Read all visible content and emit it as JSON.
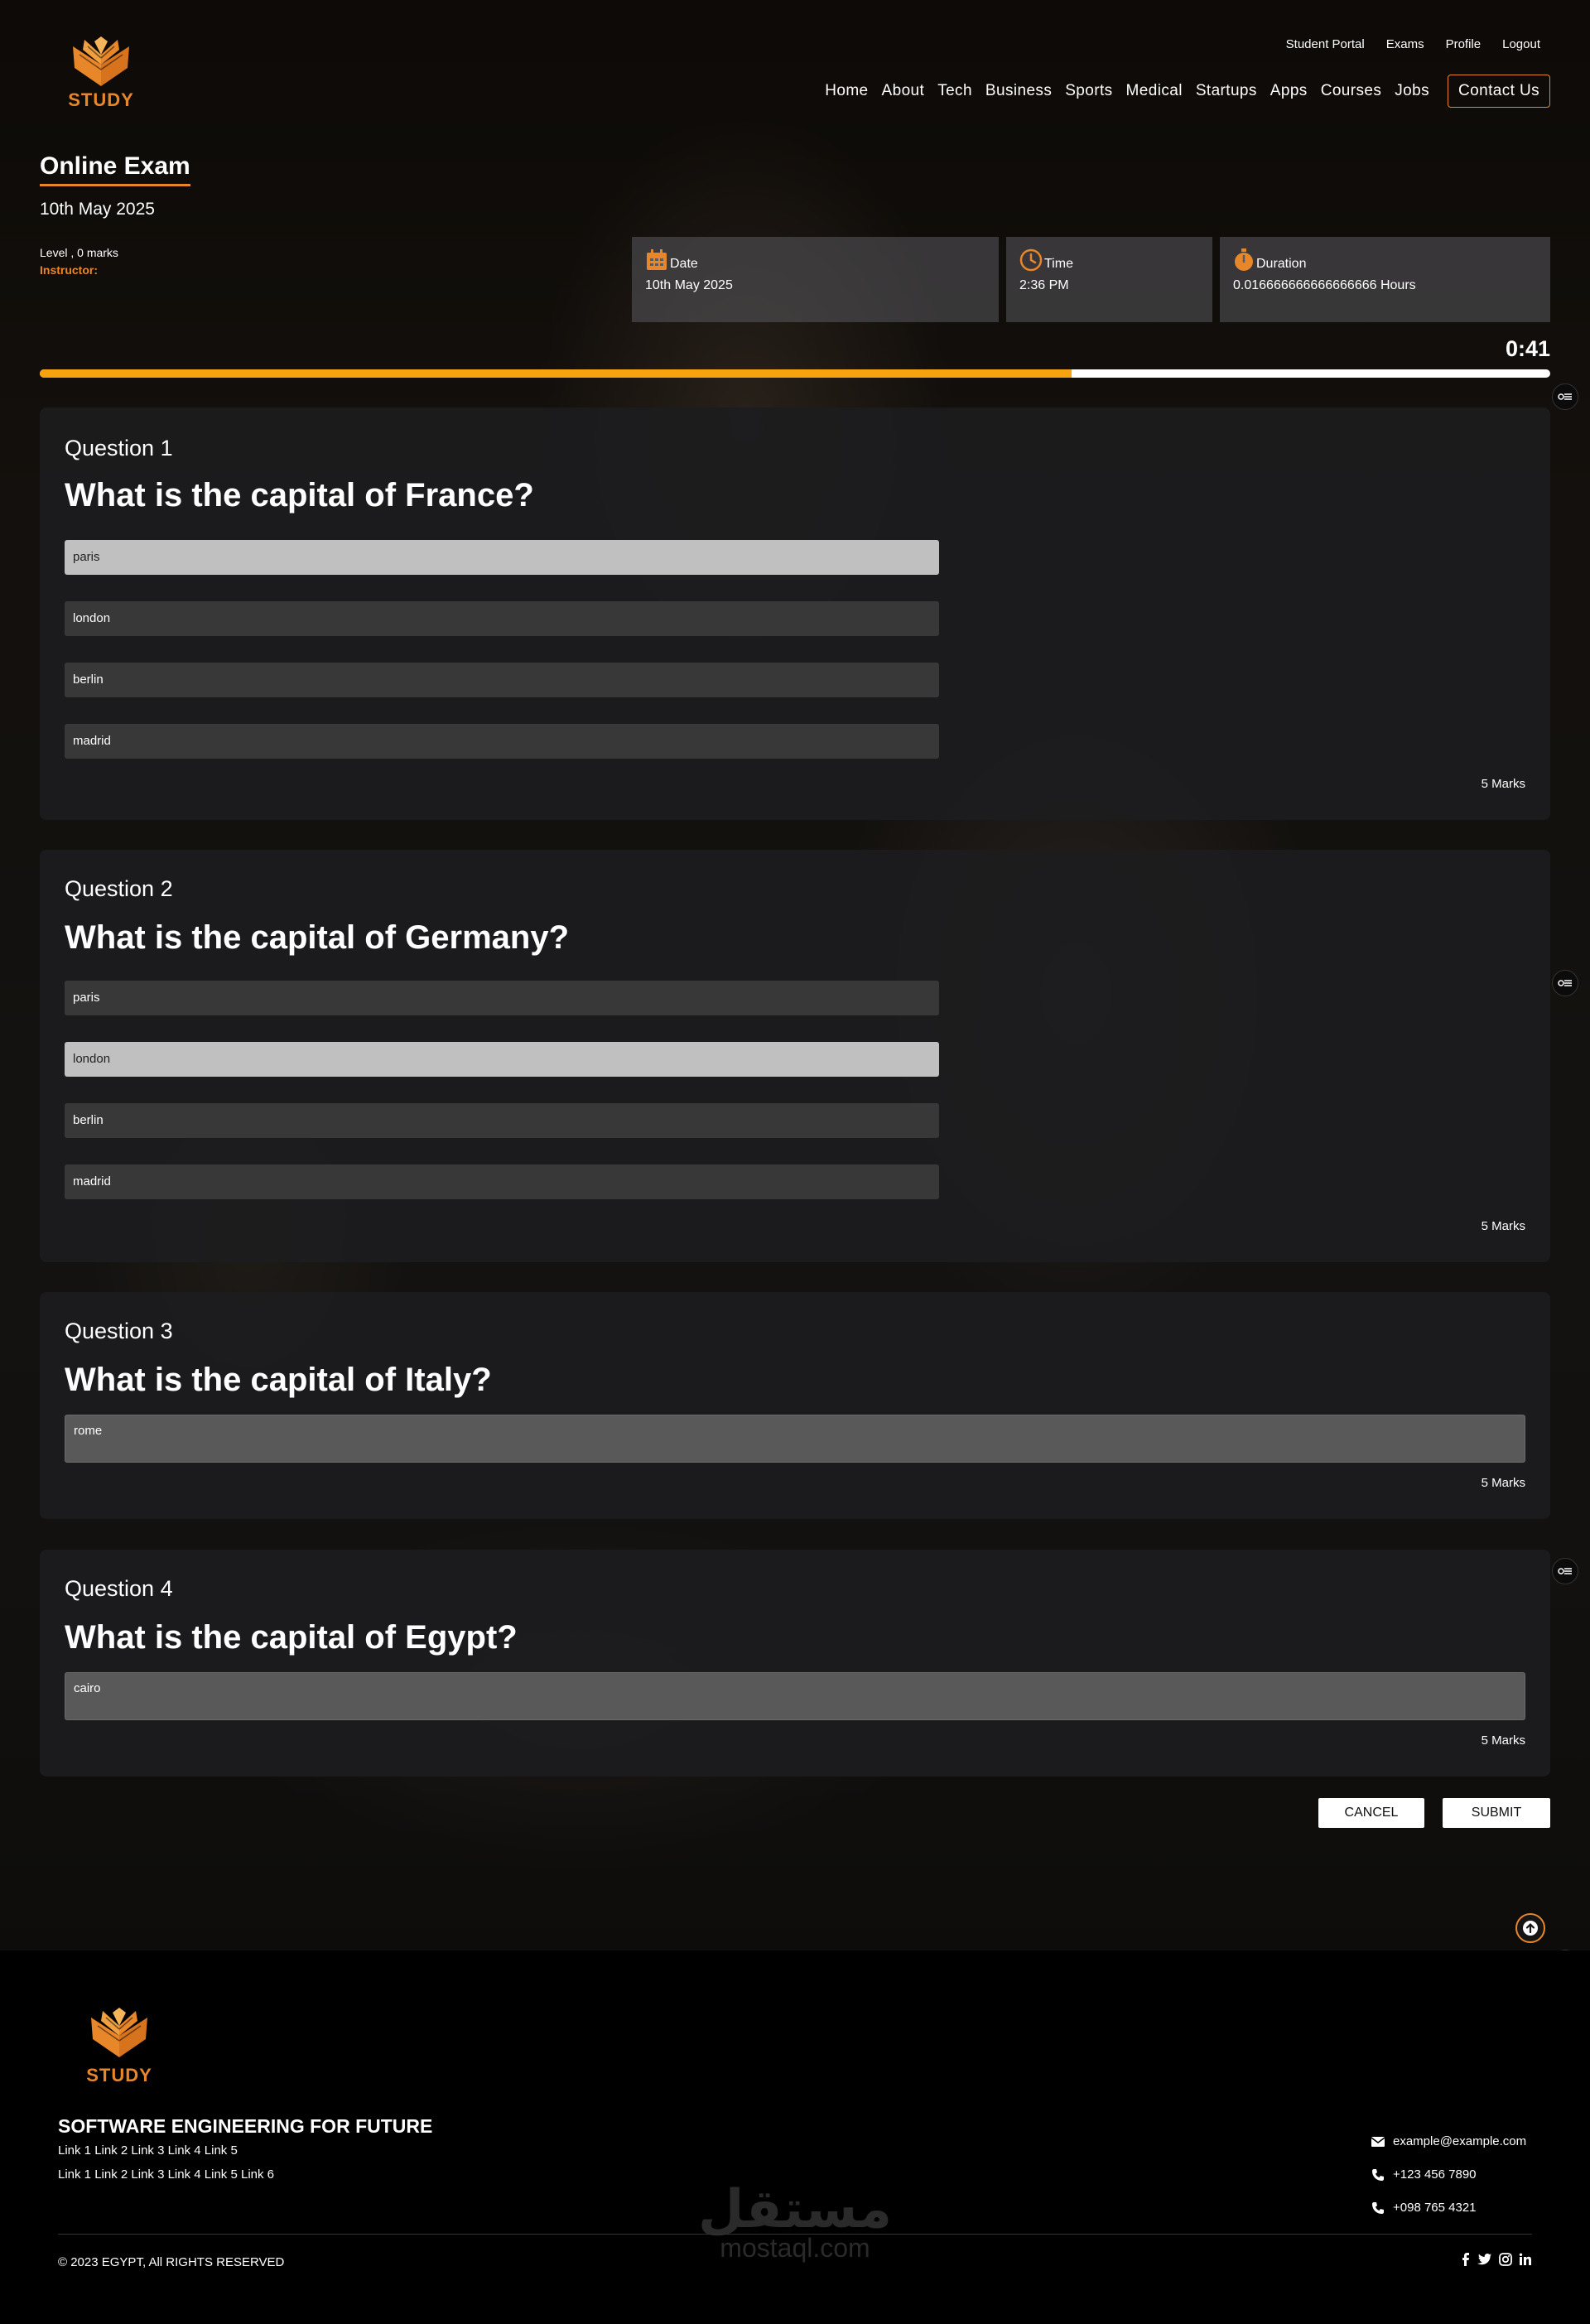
{
  "brand": {
    "name": "STUDY",
    "accent": "#e8862a",
    "progress_color": "#f7a310"
  },
  "topnav": [
    "Student Portal",
    "Exams",
    "Profile",
    "Logout"
  ],
  "mainnav": [
    "Home",
    "About",
    "Tech",
    "Business",
    "Sports",
    "Medical",
    "Startups",
    "Apps",
    "Courses",
    "Jobs"
  ],
  "contact_label": "Contact Us",
  "exam": {
    "title": "Online Exam",
    "date": "10th May 2025",
    "level": "Level , 0 marks",
    "instructor": "Instructor:",
    "cards": {
      "date_label": "Date",
      "date_value": "10th May 2025",
      "time_label": "Time",
      "time_value": "2:36 PM",
      "duration_label": "Duration",
      "duration_value": "0.016666666666666666 Hours"
    },
    "timer": "0:41",
    "progress_fraction": 0.683
  },
  "questions": [
    {
      "number": "Question 1",
      "text": "What is the capital of France?",
      "options": [
        "paris",
        "london",
        "berlin",
        "madrid"
      ],
      "selected": 0,
      "marks": "5 Marks"
    },
    {
      "number": "Question 2",
      "text": "What is the capital of Germany?",
      "options": [
        "paris",
        "london",
        "berlin",
        "madrid"
      ],
      "selected": 1,
      "marks": "5 Marks"
    },
    {
      "number": "Question 3",
      "text": "What is the capital of Italy?",
      "answer": "rome",
      "marks": "5 Marks"
    },
    {
      "number": "Question 4",
      "text": "What is the capital of Egypt?",
      "answer": "cairo",
      "marks": "5 Marks"
    }
  ],
  "actions": {
    "cancel": "CANCEL",
    "submit": "SUBMIT"
  },
  "footer": {
    "tagline": "SOFTWARE ENGINEERING FOR FUTURE",
    "links_row1": "Link 1 Link 2 Link 3 Link 4 Link 5",
    "links_row2": "Link 1 Link 2 Link 3 Link 4 Link 5 Link 6",
    "email": "example@example.com",
    "phone1": "+123 456 7890",
    "phone2": "+098 765 4321",
    "copyright": "© 2023 EGYPT, All RIGHTS RESERVED",
    "social_icons": [
      "facebook-icon",
      "twitter-icon",
      "instagram-icon",
      "linkedin-icon"
    ]
  },
  "watermark": {
    "arabic": "مستقل",
    "latin": "mostaql.com"
  }
}
